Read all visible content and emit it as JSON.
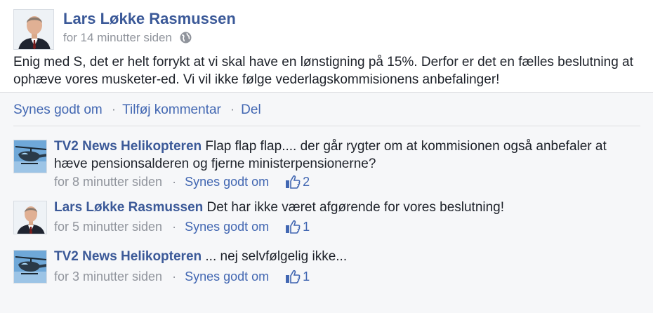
{
  "post": {
    "author": "Lars Løkke Rasmussen",
    "time": "for 14 minutter siden",
    "privacy_icon": "globe-icon",
    "text": "Enig med S, det er helt forrykt at vi skal have en lønstigning på 15%. Derfor er det en fælles beslutning at ophæve vores musketer-ed. Vi vil ikke følge vederlagskommisionens anbefalinger!"
  },
  "actions": {
    "like": "Synes godt om",
    "comment": "Tilføj kommentar",
    "share": "Del",
    "separator": "·"
  },
  "comments": [
    {
      "author": "TV2 News Helikopteren",
      "text": "Flap flap flap.... der går rygter om at kommisionen også anbefaler at hæve pensionsalderen og fjerne ministerpensionerne?",
      "time": "for 8 minutter siden",
      "like_label": "Synes godt om",
      "likes": "2",
      "avatar": "helicopter"
    },
    {
      "author": "Lars Løkke Rasmussen",
      "text": "Det har ikke været afgørende for vores beslutning!",
      "time": "for 5 minutter siden",
      "like_label": "Synes godt om",
      "likes": "1",
      "avatar": "person"
    },
    {
      "author": "TV2 News Helikopteren",
      "text": "... nej selvfølgelig ikke...",
      "time": "for 3 minutter siden",
      "like_label": "Synes godt om",
      "likes": "1",
      "avatar": "helicopter"
    }
  ],
  "colors": {
    "link_blue": "#3b5998",
    "action_blue": "#4267b2",
    "meta_gray": "#90949c",
    "comments_bg": "#f6f7f9"
  }
}
